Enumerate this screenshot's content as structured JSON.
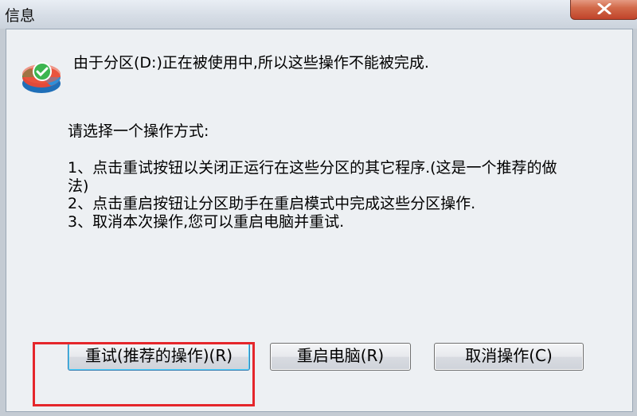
{
  "window": {
    "title": "信息"
  },
  "dialog": {
    "headline": "由于分区(D:)正在被使用中,所以这些操作不能被完成.",
    "prompt": "请选择一个操作方式:",
    "option1_line1": "1、点击重试按钮以关闭正运行在这些分区的其它程序.(这是一个推荐的做",
    "option1_line2": "法)",
    "option2": "2、点击重启按钮让分区助手在重启模式中完成这些分区操作.",
    "option3": "3、取消本次操作,您可以重启电脑并重试."
  },
  "buttons": {
    "retry": "重试(推荐的操作)(R)",
    "restart": "重启电脑(R)",
    "cancel": "取消操作(C)"
  },
  "icons": {
    "app": "partition-assistant-icon",
    "close": "close-icon"
  },
  "colors": {
    "highlight": "#e5262b",
    "close_button": "#c0432a"
  }
}
